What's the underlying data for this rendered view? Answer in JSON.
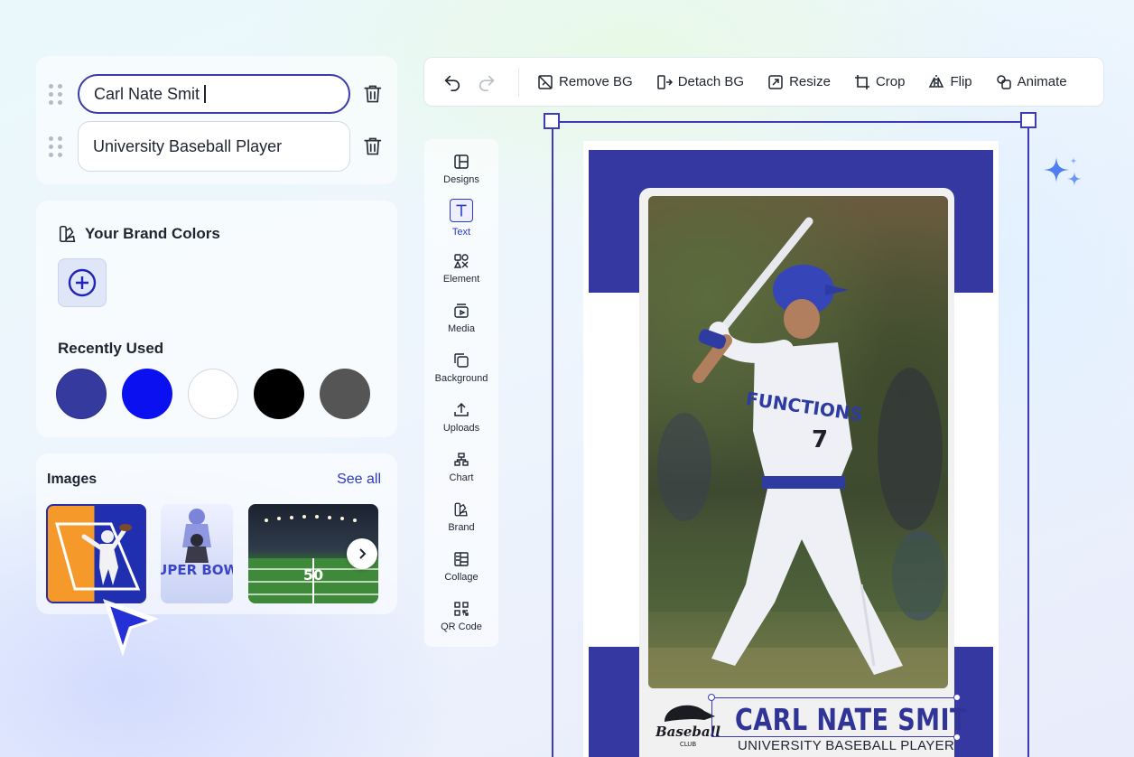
{
  "text_fields": [
    {
      "value": "Carl Nate Smit"
    },
    {
      "value": "University Baseball Player"
    }
  ],
  "brand": {
    "title": "Your Brand Colors",
    "recent_title": "Recently Used",
    "recent_colors": [
      "#353a9e",
      "#0a10f0",
      "#ffffff",
      "#000000",
      "#555555"
    ]
  },
  "images": {
    "title": "Images",
    "see_all": "See all",
    "thumb2_text": "SUPER BOWL",
    "thumb3_text": "50"
  },
  "toolbar": {
    "remove_bg": "Remove BG",
    "detach_bg": "Detach BG",
    "resize": "Resize",
    "crop": "Crop",
    "flip": "Flip",
    "animate": "Animate"
  },
  "rail": [
    {
      "label": "Designs",
      "icon": "layout-icon"
    },
    {
      "label": "Text",
      "icon": "text-icon",
      "active": true
    },
    {
      "label": "Element",
      "icon": "shapes-icon"
    },
    {
      "label": "Media",
      "icon": "media-icon"
    },
    {
      "label": "Background",
      "icon": "background-icon"
    },
    {
      "label": "Uploads",
      "icon": "upload-icon"
    },
    {
      "label": "Chart",
      "icon": "chart-icon"
    },
    {
      "label": "Brand",
      "icon": "brand-icon"
    },
    {
      "label": "Collage",
      "icon": "collage-icon"
    },
    {
      "label": "QR Code",
      "icon": "qr-code-icon"
    }
  ],
  "card": {
    "name": "CARL NATE SMIT",
    "subtitle": "UNIVERSITY BASEBALL PLAYER",
    "jersey_text": "FUNCTIONS",
    "jersey_number": "7",
    "logo_text": "Baseball",
    "logo_sub": "CLUB",
    "band_color": "#3438a0"
  },
  "colors": {
    "accent": "#2b39c8",
    "selection": "#3d3bb8"
  }
}
